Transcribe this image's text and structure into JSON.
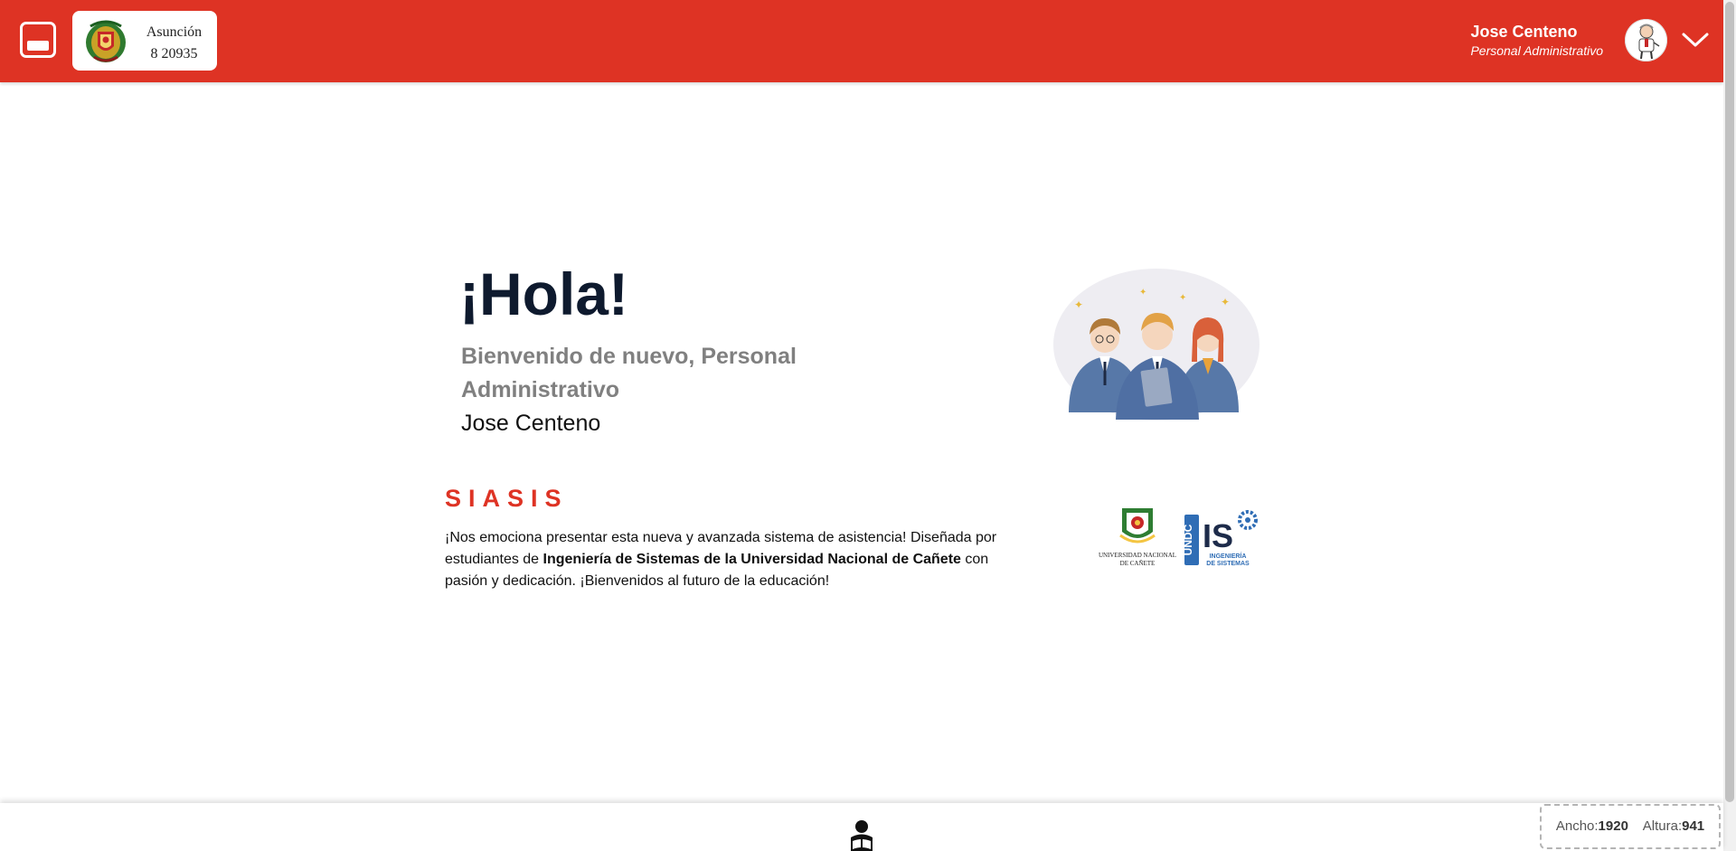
{
  "header": {
    "school_name": "Asunción",
    "school_code": "8 20935",
    "user_name": "Jose Centeno",
    "user_role": "Personal Administrativo",
    "accent_color": "#de3324"
  },
  "main": {
    "greeting": "¡Hola!",
    "welcome_line": "Bienvenido de nuevo, Personal Administrativo",
    "user_name": "Jose Centeno",
    "brand": "SIASIS",
    "description_intro": "¡Nos emociona presentar esta nueva y avanzada sistema de asistencia! Diseñada por estudiantes de ",
    "description_bold": "Ingeniería de Sistemas de la Universidad Nacional de Cañete",
    "description_outro": " con pasión y dedicación. ¡Bienvenidos al futuro de la educación!",
    "logo_undc_line1": "UNIVERSIDAD NACIONAL",
    "logo_undc_line2": "DE CAÑETE",
    "logo_is_vertical": "UNDC",
    "logo_is_letters": "IS",
    "logo_is_line1": "INGENIERÍA",
    "logo_is_line2": "DE SISTEMAS"
  },
  "footer": {
    "width_label": "Ancho:",
    "width_value": "1920",
    "height_label": "Altura:",
    "height_value": "941"
  },
  "icons": {
    "menu": "sidebar-toggle-icon",
    "crest": "school-crest-icon",
    "avatar": "user-avatar",
    "chevron": "chevron-down-icon",
    "footer": "student-reading-icon"
  }
}
